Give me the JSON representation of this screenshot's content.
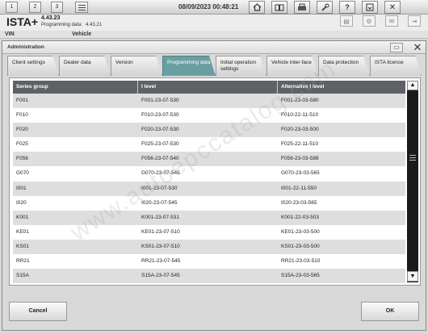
{
  "topbar": {
    "tabs": [
      "1",
      "2",
      "3"
    ],
    "datetime": "08/09/2023 00:48:21"
  },
  "header": {
    "app_title": "ISTA+",
    "version": "4.43.23",
    "programming_data_label": "Programming data:",
    "programming_data_value": "4.43.21"
  },
  "vehicle_bar": {
    "vin_label": "VIN",
    "vehicle_label": "Vehicle"
  },
  "dialog": {
    "title": "Administration",
    "tabs": [
      {
        "label": "Client settings"
      },
      {
        "label": "Dealer data"
      },
      {
        "label": "Version"
      },
      {
        "label": "Programming data",
        "active": true
      },
      {
        "label": "Initial operation settings"
      },
      {
        "label": "Vehicle inter-face"
      },
      {
        "label": "Data protection"
      },
      {
        "label": "ISTA licence"
      }
    ],
    "table": {
      "columns": [
        "Series group",
        "I level",
        "Alternative I level"
      ],
      "rows": [
        [
          "F001",
          "F001-23-07-530",
          "F001-23-03-580"
        ],
        [
          "F010",
          "F010-23-07-530",
          "F010-22-11-510"
        ],
        [
          "F020",
          "F020-23-07-530",
          "F020-23-03-500"
        ],
        [
          "F025",
          "F025-23-07-530",
          "F025-22-11-510"
        ],
        [
          "F056",
          "F056-23-07-540",
          "F056-23-03-588"
        ],
        [
          "G070",
          "G070-23-07-545",
          "G070-23-03-565"
        ],
        [
          "I001",
          "I001-23-07-530",
          "I001-22-11-550"
        ],
        [
          "I020",
          "I020-23-07-545",
          "I020-23-03-565"
        ],
        [
          "K001",
          "K001-23-07-531",
          "K001-22-03-503"
        ],
        [
          "KE01",
          "KE01-23-07-510",
          "KE01-23-03-500"
        ],
        [
          "KS01",
          "KS01-23-07-510",
          "KS01-23-03-500"
        ],
        [
          "RR21",
          "RR21-23-07-545",
          "RR21-23-03-510"
        ],
        [
          "S15A",
          "S15A-23-07-545",
          "S15A-23-03-565"
        ]
      ]
    },
    "buttons": {
      "cancel": "Cancel",
      "ok": "OK"
    }
  },
  "watermark": "www.autoepccatalog.com",
  "colors": {
    "active_tab": "#6a9fa2",
    "table_header": "#5e6266",
    "row_stripe": "#dedede"
  }
}
